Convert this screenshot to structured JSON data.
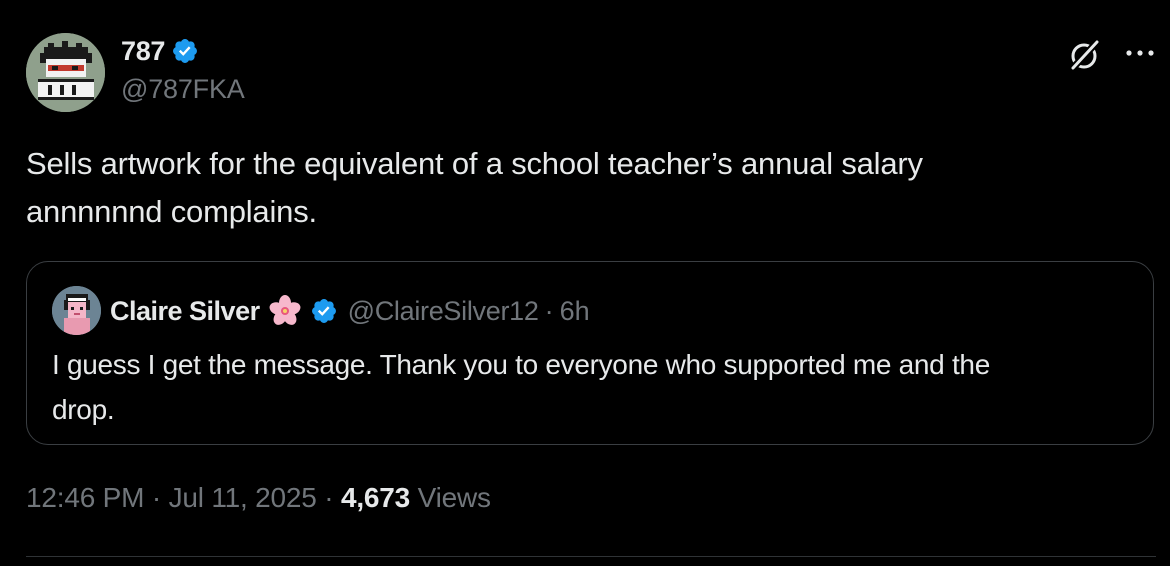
{
  "author": {
    "name": "787",
    "handle": "@787FKA",
    "verified": true
  },
  "tweet": {
    "text_line1": "Sells artwork for the equivalent of a school teacher’s annual salary",
    "text_line2": "annnnnnd complains."
  },
  "quote": {
    "name": "Claire Silver",
    "emoji": "🌸",
    "handle": "@ClaireSilver12",
    "separator": "·",
    "time": "6h",
    "text_line1": "I guess I get the message. Thank you to everyone who supported me and the",
    "text_line2": "drop."
  },
  "meta": {
    "time": "12:46 PM",
    "sep1": "·",
    "date": "Jul 11, 2025",
    "sep2": "·",
    "views_count": "4,673",
    "views_label": "Views"
  },
  "icons": {
    "verified": "verified-badge-icon",
    "grok": "grok-icon",
    "more": "more-icon",
    "flower": "cherry-blossom-icon"
  },
  "colors": {
    "background": "#000000",
    "text_primary": "#e7e9ea",
    "text_secondary": "#71767b",
    "verified_blue": "#1d9bf0",
    "border": "#3a3e42"
  }
}
